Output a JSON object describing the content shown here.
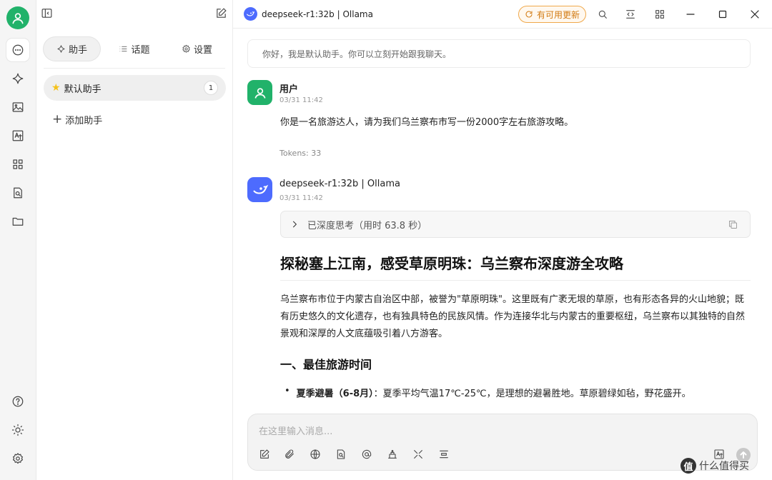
{
  "colors": {
    "accent": "#21b26a",
    "brand": "#4d6bfe",
    "update": "#d27a12"
  },
  "rail": {
    "top_icons": [
      "chat-icon",
      "sparkle-icon",
      "image-icon",
      "translate-icon",
      "apps-icon",
      "search-document-icon",
      "folder-icon"
    ],
    "bottom_icons": [
      "help-icon",
      "theme-icon",
      "settings-icon"
    ]
  },
  "panel": {
    "tabs": [
      {
        "label": "助手",
        "icon": "sparkle-icon"
      },
      {
        "label": "话题",
        "icon": "list-icon"
      },
      {
        "label": "设置",
        "icon": "gear-icon"
      }
    ],
    "assistant": {
      "name": "默认助手",
      "count": "1"
    },
    "add_label": "添加助手"
  },
  "header": {
    "title": "deepseek-r1:32b | Ollama",
    "update_label": "有可用更新"
  },
  "chat": {
    "greeting": "你好，我是默认助手。你可以立刻开始跟我聊天。",
    "user": {
      "name": "用户",
      "time": "03/31 11:42",
      "text": "你是一名旅游达人，请为我们乌兰察布市写一份2000字左右旅游攻略。",
      "tokens": "Tokens: 33"
    },
    "bot": {
      "name": "deepseek-r1:32b | Ollama",
      "time": "03/31 11:42",
      "think_label": "已深度思考（用时 63.8 秒）",
      "heading": "探秘塞上江南，感受草原明珠：乌兰察布深度游全攻略",
      "paragraph": "乌兰察布市位于内蒙古自治区中部，被誉为\"草原明珠\"。这里既有广袤无垠的草原，也有形态各异的火山地貌；既有历史悠久的文化遗存，也有独具特色的民族风情。作为连接华北与内蒙古的重要枢纽，乌兰察布以其独特的自然景观和深厚的人文底蕴吸引着八方游客。",
      "section_title": "一、最佳旅游时间",
      "bullet_bold": "夏季避暑（6-8月）",
      "bullet_text": "：夏季平均气温17℃-25℃，是理想的避暑胜地。草原碧绿如毡，野花盛开。"
    }
  },
  "input": {
    "placeholder": "在这里输入消息...",
    "tools": [
      "edit-icon",
      "attachment-icon",
      "globe-icon",
      "knowledge-icon",
      "mention-icon",
      "clear-icon",
      "expand-icon",
      "new-topic-icon"
    ]
  },
  "watermark": {
    "badge": "值",
    "text": "什么值得买"
  }
}
